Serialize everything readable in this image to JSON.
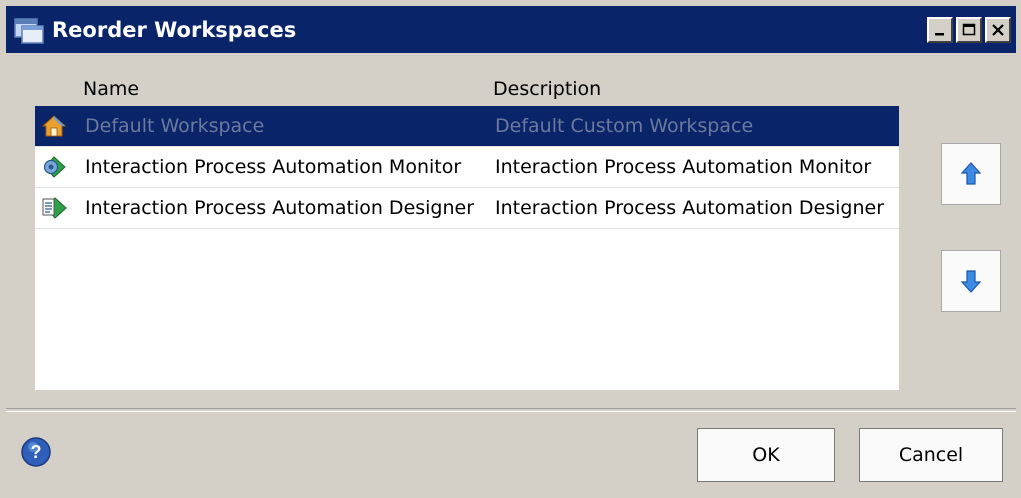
{
  "window": {
    "title": "Reorder Workspaces",
    "controls": [
      "minimize-icon",
      "maximize-icon",
      "close-icon"
    ]
  },
  "list": {
    "columns": [
      "Name",
      "Description"
    ],
    "rows": [
      {
        "icon": "house-icon",
        "name": "Default Workspace",
        "description": "Default Custom Workspace",
        "selected": true
      },
      {
        "icon": "monitor-gear-icon",
        "name": "Interaction Process Automation Monitor",
        "description": "Interaction Process Automation Monitor",
        "selected": false
      },
      {
        "icon": "designer-arrow-icon",
        "name": "Interaction Process Automation Designer",
        "description": "Interaction Process Automation Designer",
        "selected": false
      }
    ]
  },
  "side_buttons": {
    "up_icon": "arrow-up-icon",
    "down_icon": "arrow-down-icon"
  },
  "footer": {
    "help_icon": "help-icon",
    "ok_label": "OK",
    "cancel_label": "Cancel"
  },
  "colors": {
    "titlebar": "#0a246a",
    "selection": "#0a246a",
    "dialog_bg": "#d4d0c8",
    "arrow_blue": "#2b6fd6"
  }
}
